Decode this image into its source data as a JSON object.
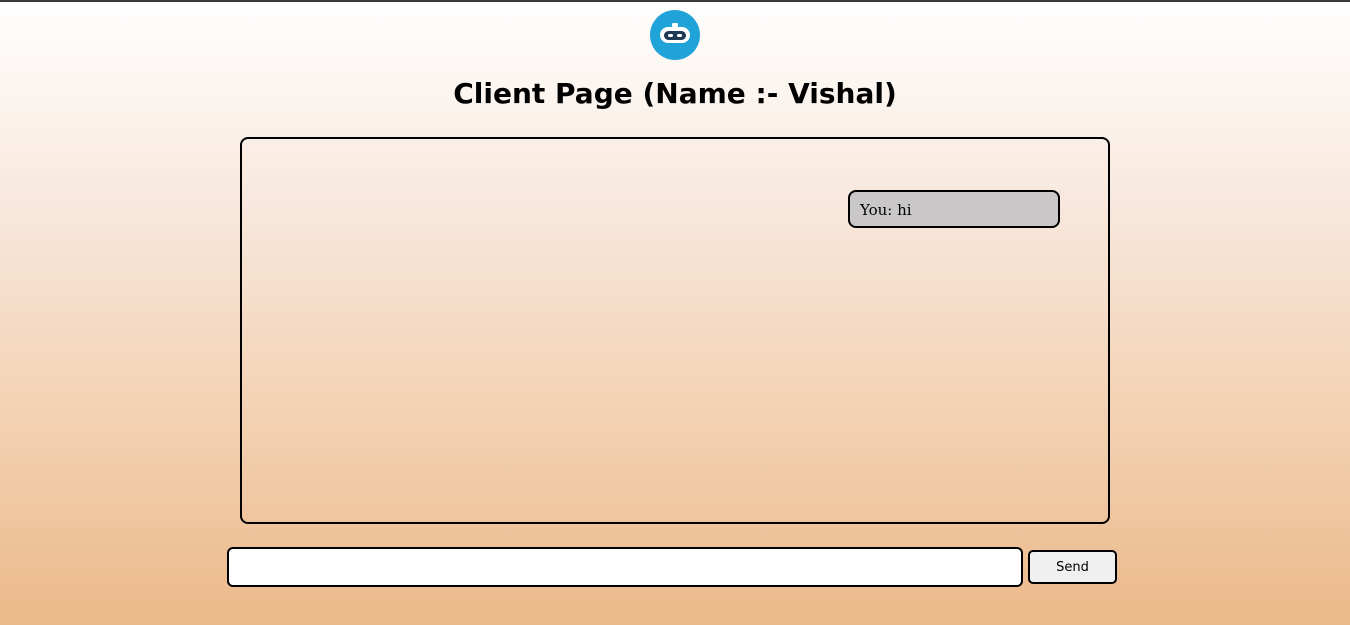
{
  "header": {
    "logo_icon": "robot-icon",
    "logo_color": "#1fa3d8",
    "title": "Client Page (Name :- Vishal)"
  },
  "chat": {
    "messages": [
      {
        "text": "You: hi"
      }
    ]
  },
  "composer": {
    "input_value": "",
    "input_placeholder": "",
    "send_label": "Send"
  }
}
